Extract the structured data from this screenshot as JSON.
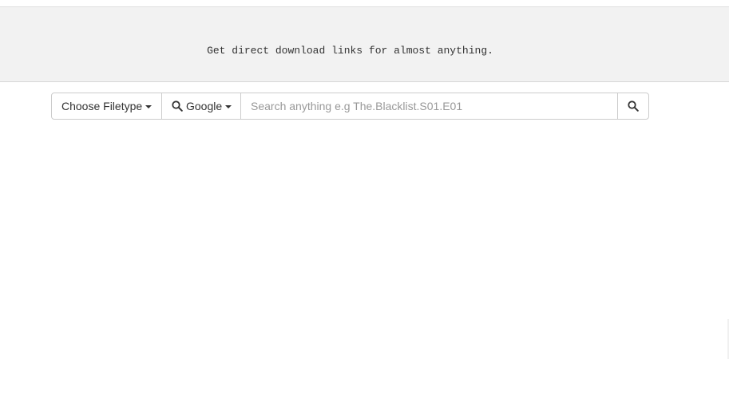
{
  "hero": {
    "tagline": "Get direct download links for almost anything."
  },
  "search": {
    "filetype_label": "Choose Filetype",
    "engine_label": "Google",
    "placeholder": "Search anything e.g The.Blacklist.S01.E01",
    "value": ""
  },
  "icons": {
    "engine_icon": "search-icon",
    "submit_icon": "search-icon"
  },
  "colors": {
    "hero_bg": "#f2f2f2",
    "border": "#cccccc",
    "text": "#333333",
    "placeholder": "#999999"
  }
}
